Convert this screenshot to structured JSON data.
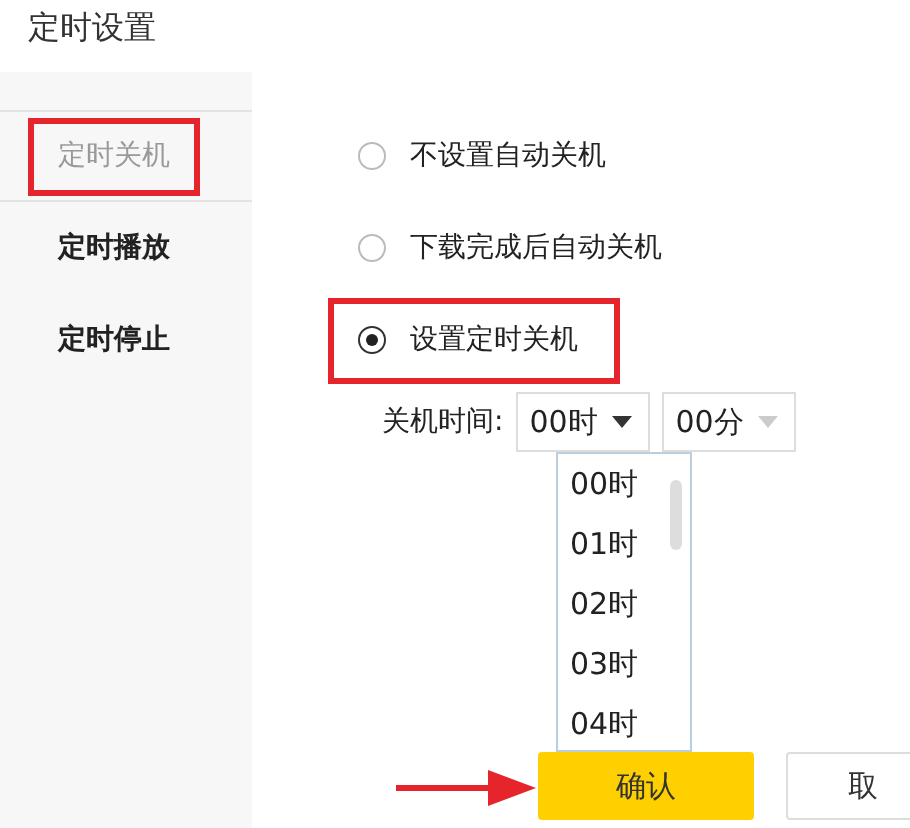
{
  "title": "定时设置",
  "sidebar": {
    "items": [
      {
        "label": "定时关机",
        "selected": true,
        "highlighted": true
      },
      {
        "label": "定时播放",
        "selected": false,
        "highlighted": false
      },
      {
        "label": "定时停止",
        "selected": false,
        "highlighted": false
      }
    ]
  },
  "options": [
    {
      "label": "不设置自动关机",
      "selected": false,
      "highlighted": false
    },
    {
      "label": "下载完成后自动关机",
      "selected": false,
      "highlighted": false
    },
    {
      "label": "设置定时关机",
      "selected": true,
      "highlighted": true
    }
  ],
  "time": {
    "label": "关机时间:",
    "hour": "00时",
    "minute": "00分",
    "minute_disabled": true
  },
  "hour_list": {
    "expanded": true,
    "items": [
      "00时",
      "01时",
      "02时",
      "03时",
      "04时"
    ]
  },
  "buttons": [
    {
      "label": "确认",
      "kind": "primary",
      "arrow": true
    },
    {
      "label": "取",
      "kind": "secondary",
      "arrow": false
    }
  ]
}
